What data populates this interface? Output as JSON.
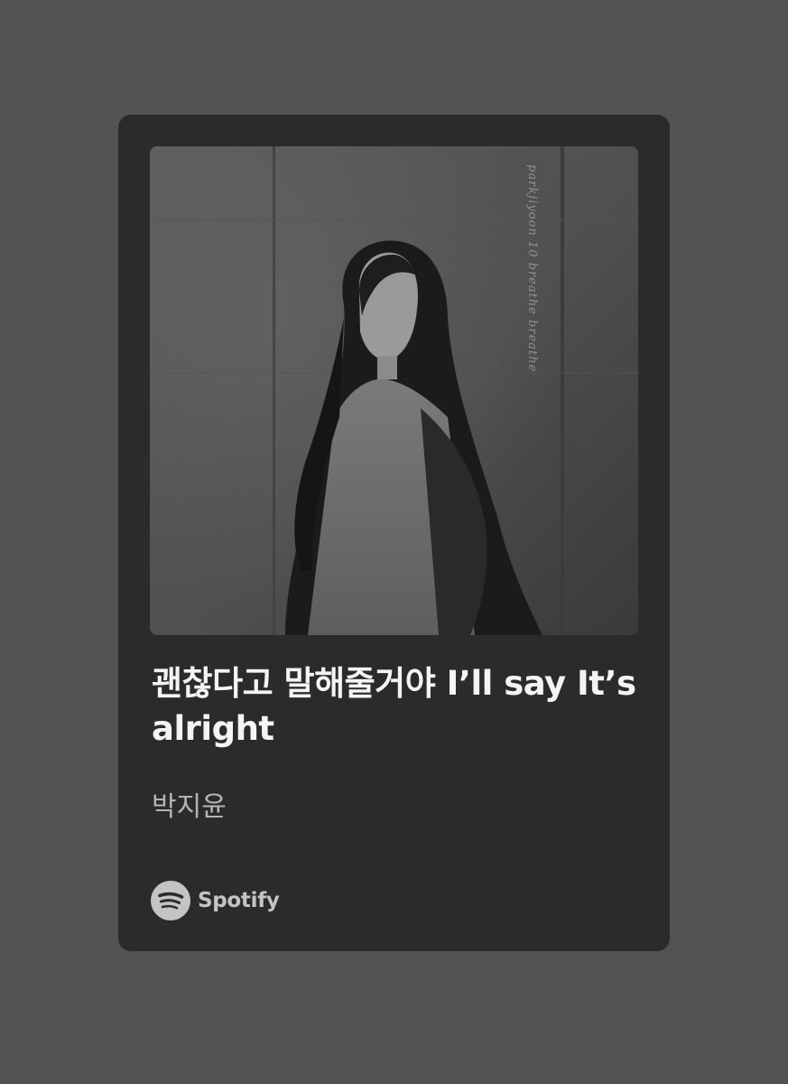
{
  "card": {
    "track_title": "괜찮다고 말해줄거야 I’ll say It’s alright",
    "artist": "박지윤",
    "cover_handwriting": "parkjiyoon 10 breathe breathe",
    "cover_icon": "album-cover-image"
  },
  "branding": {
    "icon": "spotify-logo-icon",
    "name": "Spotify"
  },
  "colors": {
    "background": "#535353",
    "card": "#2b2b2b",
    "title": "#f4f4f4",
    "artist": "#b5b5b5",
    "brand": "#c4c4c4"
  }
}
